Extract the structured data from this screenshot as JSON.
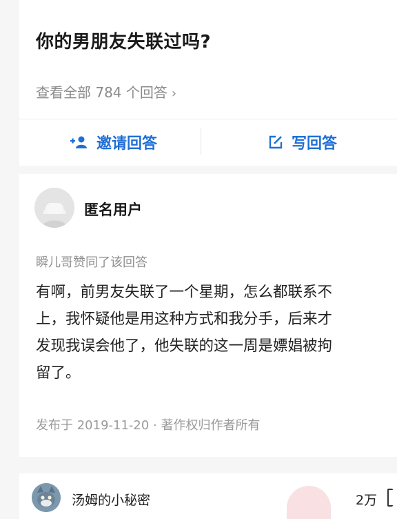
{
  "question": {
    "title": "你的男朋友失联过吗?",
    "view_all": "查看全部 784 个回答",
    "chevron": "›"
  },
  "actions": {
    "invite_label": "邀请回答",
    "write_label": "写回答"
  },
  "answer": {
    "author": "匿名用户",
    "liked_by": "瞬儿哥赞同了该回答",
    "lines": [
      "有啊，前男友失联了一个星期，怎么都联系不",
      "上，我怀疑他是用这种方式和我分手，后来才",
      "发现我误会他了，他失联的这一周是嫖娼被拘",
      "留了。"
    ],
    "meta": "发布于 2019-11-20 · 著作权归作者所有"
  },
  "next_answer": {
    "author": "汤姆的小秘密",
    "count": "2万"
  },
  "colors": {
    "accent": "#1f6fd6",
    "muted_text": "#8a8a8a",
    "background": "#f6f6f6"
  },
  "icons": {
    "invite": "add-user-icon",
    "write": "edit-icon"
  }
}
